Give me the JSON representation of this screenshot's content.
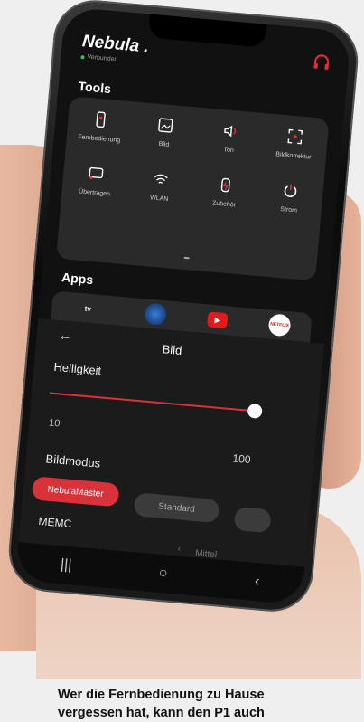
{
  "app": {
    "title": "Nebula .",
    "status": "Verbunden"
  },
  "sections": {
    "tools": "Tools",
    "apps": "Apps"
  },
  "tools": [
    {
      "label": "Fernbedienung",
      "icon": "remote-icon"
    },
    {
      "label": "Bild",
      "icon": "picture-icon"
    },
    {
      "label": "Ton",
      "icon": "speaker-icon"
    },
    {
      "label": "Bildkorrektur",
      "icon": "focus-icon"
    },
    {
      "label": "Übertragen",
      "icon": "cast-icon"
    },
    {
      "label": "WLAN",
      "icon": "wifi-icon"
    },
    {
      "label": "Zubehör",
      "icon": "accessory-icon"
    },
    {
      "label": "Strom",
      "icon": "power-icon"
    }
  ],
  "apps_row": [
    {
      "label": "tv",
      "icon": "appletv-icon"
    },
    {
      "label": "",
      "icon": "disney-icon"
    },
    {
      "label": "▶",
      "icon": "youtube-icon"
    },
    {
      "label": "NETFLIX",
      "icon": "netflix-icon"
    }
  ],
  "picture": {
    "back": "←",
    "header": "Bild",
    "brightness_label": "Helligkeit",
    "brightness_min": "10",
    "brightness_max": "100",
    "brightness_value": 1.0,
    "mode_label": "Bildmodus",
    "modes": [
      "NebulaMaster",
      "Standard"
    ],
    "active_mode": "NebulaMaster",
    "memc_label": "MEMC",
    "memc_value": "Mittel",
    "memc_prev": "‹",
    "memc_next": "›"
  },
  "navbar": {
    "recent": "|||",
    "home": "○",
    "back": "‹"
  },
  "caption": "Wer die Fernbedienung zu Hause vergessen hat, kann den P1 auch",
  "colors": {
    "accent": "#d8323a",
    "panel": "#2a2a2a",
    "screen": "#111111"
  }
}
